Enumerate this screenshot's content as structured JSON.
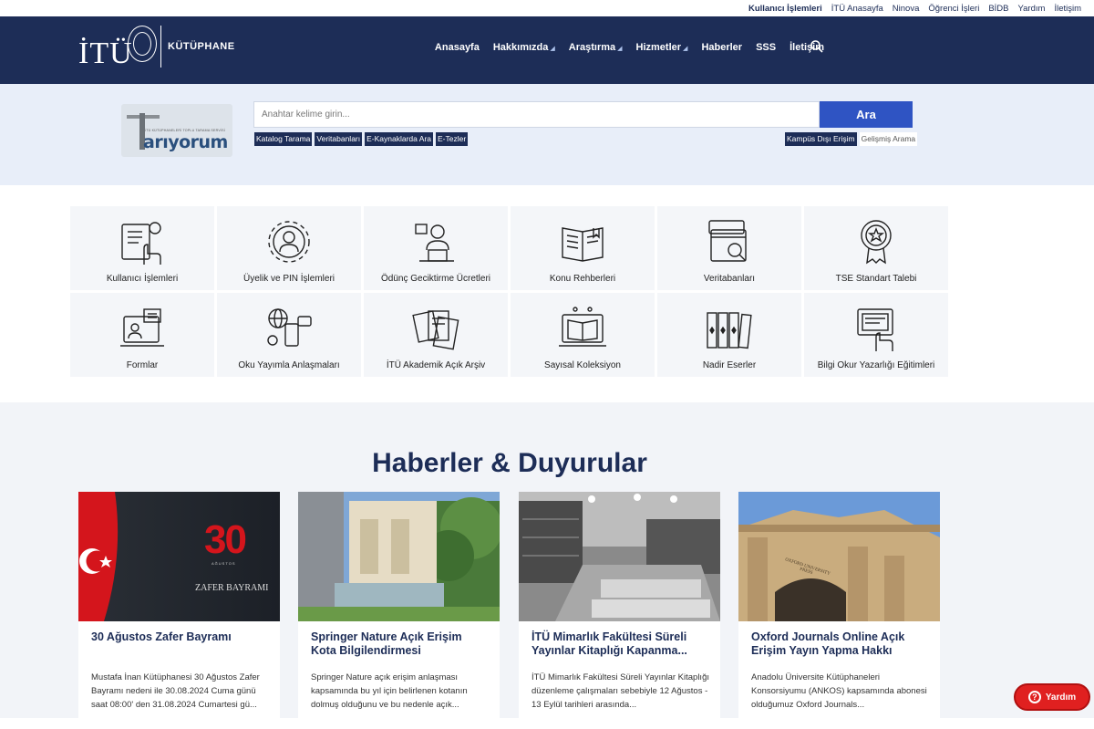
{
  "topbar": {
    "items": [
      "Kullanıcı İşlemleri",
      "İTÜ Anasayfa",
      "Ninova",
      "Öğrenci İşleri",
      "BİDB",
      "Yardım",
      "İletişim"
    ]
  },
  "header": {
    "logo_text": "İTÜ",
    "library_label": "KÜTÜPHANE",
    "nav": [
      {
        "label": "Anasayfa",
        "caret": false
      },
      {
        "label": "Hakkımızda",
        "caret": true
      },
      {
        "label": "Araştırma",
        "caret": true
      },
      {
        "label": "Hizmetler",
        "caret": true
      },
      {
        "label": "Haberler",
        "caret": false
      },
      {
        "label": "SSS",
        "caret": false
      },
      {
        "label": "İletişim",
        "caret": false
      }
    ]
  },
  "search": {
    "logo_small": "İTÜ KÜTÜPHANELERİ TOPLU TARAMA SERVİSİ",
    "logo_text": "arıyorum",
    "placeholder": "Anahtar kelime girin...",
    "button": "Ara",
    "tags_left": [
      "Katalog Tarama",
      "Veritabanları",
      "E-Kaynaklarda Ara",
      "E-Tezler"
    ],
    "tags_right": [
      "Kampüs Dışı Erişim",
      "Gelişmiş Arama"
    ]
  },
  "tiles": [
    {
      "label": "Kullanıcı İşlemleri",
      "icon": "user-touch-icon"
    },
    {
      "label": "Üyelik ve PIN İşlemleri",
      "icon": "gear-user-icon"
    },
    {
      "label": "Ödünç Geciktirme Ücretleri",
      "icon": "librarian-icon"
    },
    {
      "label": "Konu Rehberleri",
      "icon": "open-book-icon"
    },
    {
      "label": "Veritabanları",
      "icon": "browser-search-icon"
    },
    {
      "label": "TSE Standart Talebi",
      "icon": "badge-icon"
    },
    {
      "label": "Formlar",
      "icon": "laptop-form-icon"
    },
    {
      "label": "Oku Yayımla Anlaşmaları",
      "icon": "network-devices-icon"
    },
    {
      "label": "İTÜ Akademik Açık Arşiv",
      "icon": "documents-icon"
    },
    {
      "label": "Sayısal Koleksiyon",
      "icon": "digital-book-icon"
    },
    {
      "label": "Nadir Eserler",
      "icon": "bookshelf-icon"
    },
    {
      "label": "Bilgi Okur Yazarlığı Eğitimleri",
      "icon": "screen-touch-icon"
    }
  ],
  "news": {
    "heading": "Haberler & Duyurular",
    "cards": [
      {
        "title": "30 Ağustos Zafer Bayramı",
        "text": "Mustafa İnan Kütüphanesi 30 Ağustos Zafer Bayramı nedeni ile 30.08.2024 Cuma günü saat 08:00' den 31.08.2024 Cumartesi gü...",
        "img_big": "30",
        "img_small": "AĞUSTOS",
        "img_caption": "ZAFER BAYRAMI"
      },
      {
        "title": "Springer Nature Açık Erişim Kota Bilgilendirmesi",
        "text": "Springer Nature açık erişim anlaşması kapsamında bu yıl için belirlenen kotanın dolmuş olduğunu ve bu nedenle açık..."
      },
      {
        "title": "İTÜ Mimarlık Fakültesi Süreli Yayınlar Kitaplığı Kapanma...",
        "text": "İTÜ Mimarlık Fakültesi Süreli Yayınlar Kitaplığı düzenleme çalışmaları sebebiyle 12 Ağustos - 13 Eylül tarihleri arasında..."
      },
      {
        "title": "Oxford Journals Online Açık Erişim Yayın Yapma Hakkı",
        "text": "Anadolu Üniversite Kütüphaneleri Konsorsiyumu (ANKOS) kapsamında abonesi olduğumuz Oxford Journals...",
        "img_sign": "OXFORD UNIVERSITY PRESS"
      }
    ]
  },
  "help": {
    "label": "Yardım",
    "icon_glyph": "?"
  },
  "colors": {
    "navy": "#1d2d57",
    "accent_blue": "#2f54c3",
    "help_red": "#e02020"
  }
}
